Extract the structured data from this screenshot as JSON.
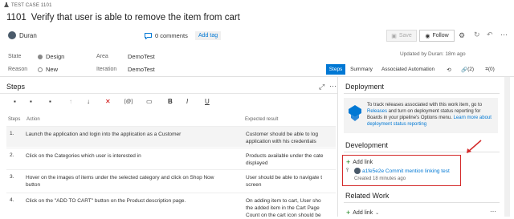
{
  "header": {
    "type_label": "TEST CASE 1101",
    "id": "1101",
    "title": "Verify that user is able to remove the item from cart",
    "assigned_user": "Duran",
    "comments": "0 comments",
    "add_tag": "Add tag",
    "save_label": "Save",
    "follow_label": "Follow"
  },
  "fields": {
    "state_label": "State",
    "state_value": "Design",
    "reason_label": "Reason",
    "reason_value": "New",
    "area_label": "Area",
    "area_value": "DemoTest",
    "iteration_label": "Iteration",
    "iteration_value": "DemoTest",
    "updated": "Updated by Duran: 18m ago"
  },
  "tabs": [
    "Steps",
    "Summary",
    "Associated Automation"
  ],
  "tab_counts": {
    "history": "",
    "links": "(2)",
    "attachments": "(0)"
  },
  "steps": {
    "title": "Steps",
    "col_steps": "Steps",
    "col_action": "Action",
    "col_expected": "Expected result",
    "rows": [
      {
        "n": "1.",
        "action": "Launch the application and login into the application as a Customer",
        "expected1": "Customer  should be able to log",
        "expected2": "application with his credentials"
      },
      {
        "n": "2.",
        "action": "Click on the Categories which user is interested in",
        "expected1": "Products available under the cate",
        "expected2": "displayed"
      },
      {
        "n": "3.",
        "action": "Hover on the images of items under the selected category and click on Shop Now",
        "action2": "button",
        "expected1": "User should be able to navigate t",
        "expected2": "screen"
      },
      {
        "n": "4.",
        "action": "Click on the \"ADD TO CART\" button on the Product description page.",
        "expected1": "On adding item to cart, User sho",
        "expected2": "the added item in the Cart Page",
        "expected3": "Count on the cart icon should be"
      }
    ]
  },
  "deployment": {
    "title": "Deployment",
    "text_a": "To track releases associated with this work item, go to",
    "text_b_link": "Releases",
    "text_b": " and turn on deployment status reporting for",
    "text_c": "Boards in your pipeline's Options menu. ",
    "text_c_link": "Learn more",
    "text_d_link": "about deployment status reporting"
  },
  "development": {
    "title": "Development",
    "add_link": "Add link",
    "commit_label": "a1fe5e2e Commit mention linking test",
    "created": "Created 18 minutes ago"
  },
  "related": {
    "title": "Related Work",
    "add_link": "Add link"
  },
  "colors": {
    "accent": "#0078d4",
    "highlight_border": "#d42b2b",
    "design_dot": "#888888"
  }
}
